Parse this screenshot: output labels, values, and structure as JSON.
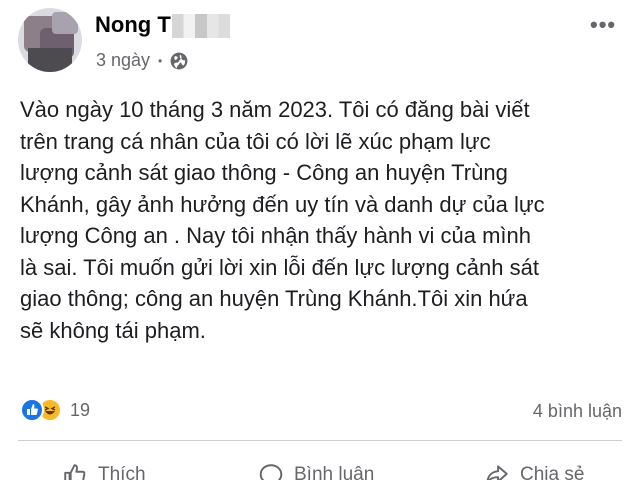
{
  "post": {
    "author_name": "Nong T",
    "time": "3 ngày",
    "privacy_icon": "globe-icon",
    "more_icon": "more-options-icon",
    "body_lines": [
      "Vào ngày 10 tháng 3 năm 2023. Tôi có đăng bài viết",
      "trên trang cá nhân của tôi có lời lẽ xúc phạm lực",
      "lượng cảnh sát giao thông - Công an huyện Trùng",
      "Khánh, gây ảnh hưởng đến uy tín và danh dự của lực",
      "lượng Công an . Nay tôi nhận thấy hành vi của mình",
      "là sai. Tôi muốn gửi lời xin lỗi đến lực lượng cảnh sát",
      "giao thông; công an huyện Trùng Khánh.Tôi xin hứa",
      "sẽ không tái phạm."
    ],
    "reactions": {
      "icons": [
        "like-reaction-icon",
        "haha-reaction-icon"
      ],
      "count": "19"
    },
    "comments_count": "4 bình luận",
    "actions": {
      "like": "Thích",
      "comment": "Bình luận",
      "share": "Chia sẻ"
    },
    "colors": {
      "like_blue": "#1b74e4",
      "haha_yellow": "#f7b928",
      "secondary_text": "#65676b"
    }
  }
}
